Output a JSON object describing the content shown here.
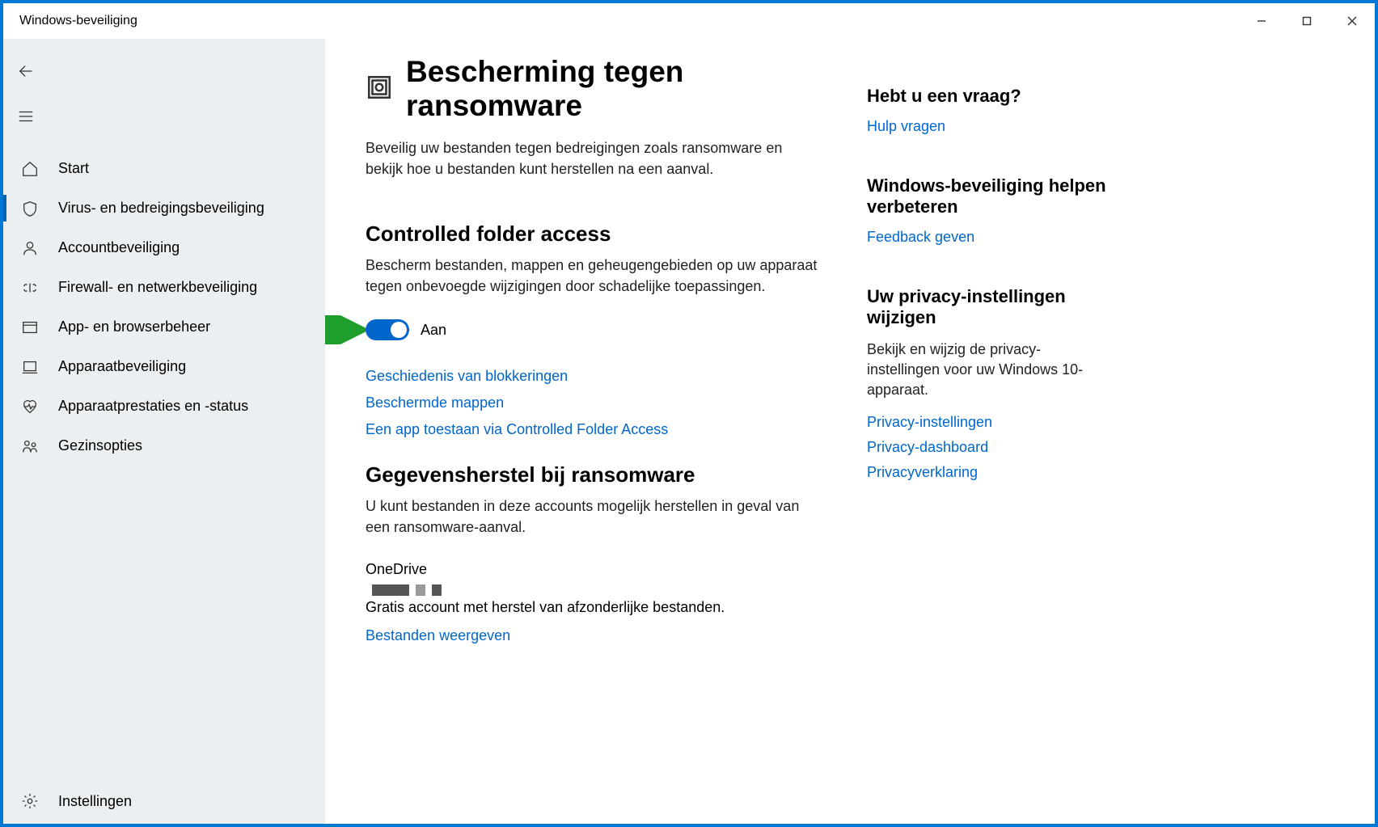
{
  "window": {
    "title": "Windows-beveiliging"
  },
  "sidebar": {
    "items": [
      {
        "label": "Start"
      },
      {
        "label": "Virus- en bedreigingsbeveiliging"
      },
      {
        "label": "Accountbeveiliging"
      },
      {
        "label": "Firewall- en netwerkbeveiliging"
      },
      {
        "label": "App- en browserbeheer"
      },
      {
        "label": "Apparaatbeveiliging"
      },
      {
        "label": "Apparaatprestaties en -status"
      },
      {
        "label": "Gezinsopties"
      }
    ],
    "settings_label": "Instellingen"
  },
  "page": {
    "title": "Bescherming tegen ransomware",
    "description": "Beveilig uw bestanden tegen bedreigingen zoals ransomware en bekijk hoe u bestanden kunt herstellen na een aanval."
  },
  "cfa": {
    "heading": "Controlled folder access",
    "description": "Bescherm bestanden, mappen en geheugengebieden op uw apparaat tegen onbevoegde wijzigingen door schadelijke toepassingen.",
    "toggle_state": "Aan",
    "links": {
      "history": "Geschiedenis van blokkeringen",
      "protected_folders": "Beschermde mappen",
      "allow_app": "Een app toestaan via Controlled Folder Access"
    }
  },
  "recovery": {
    "heading": "Gegevensherstel bij ransomware",
    "description": "U kunt bestanden in deze accounts mogelijk herstellen in geval van een ransomware-aanval.",
    "onedrive_label": "OneDrive",
    "onedrive_desc": "Gratis account met herstel van afzonderlijke bestanden.",
    "view_files": "Bestanden weergeven"
  },
  "aside": {
    "help": {
      "heading": "Hebt u een vraag?",
      "link": "Hulp vragen"
    },
    "improve": {
      "heading": "Windows-beveiliging helpen verbeteren",
      "link": "Feedback geven"
    },
    "privacy": {
      "heading": "Uw privacy-instellingen wijzigen",
      "description": "Bekijk en wijzig de privacy-instellingen voor uw Windows 10-apparaat.",
      "links": {
        "settings": "Privacy-instellingen",
        "dashboard": "Privacy-dashboard",
        "statement": "Privacyverklaring"
      }
    }
  }
}
